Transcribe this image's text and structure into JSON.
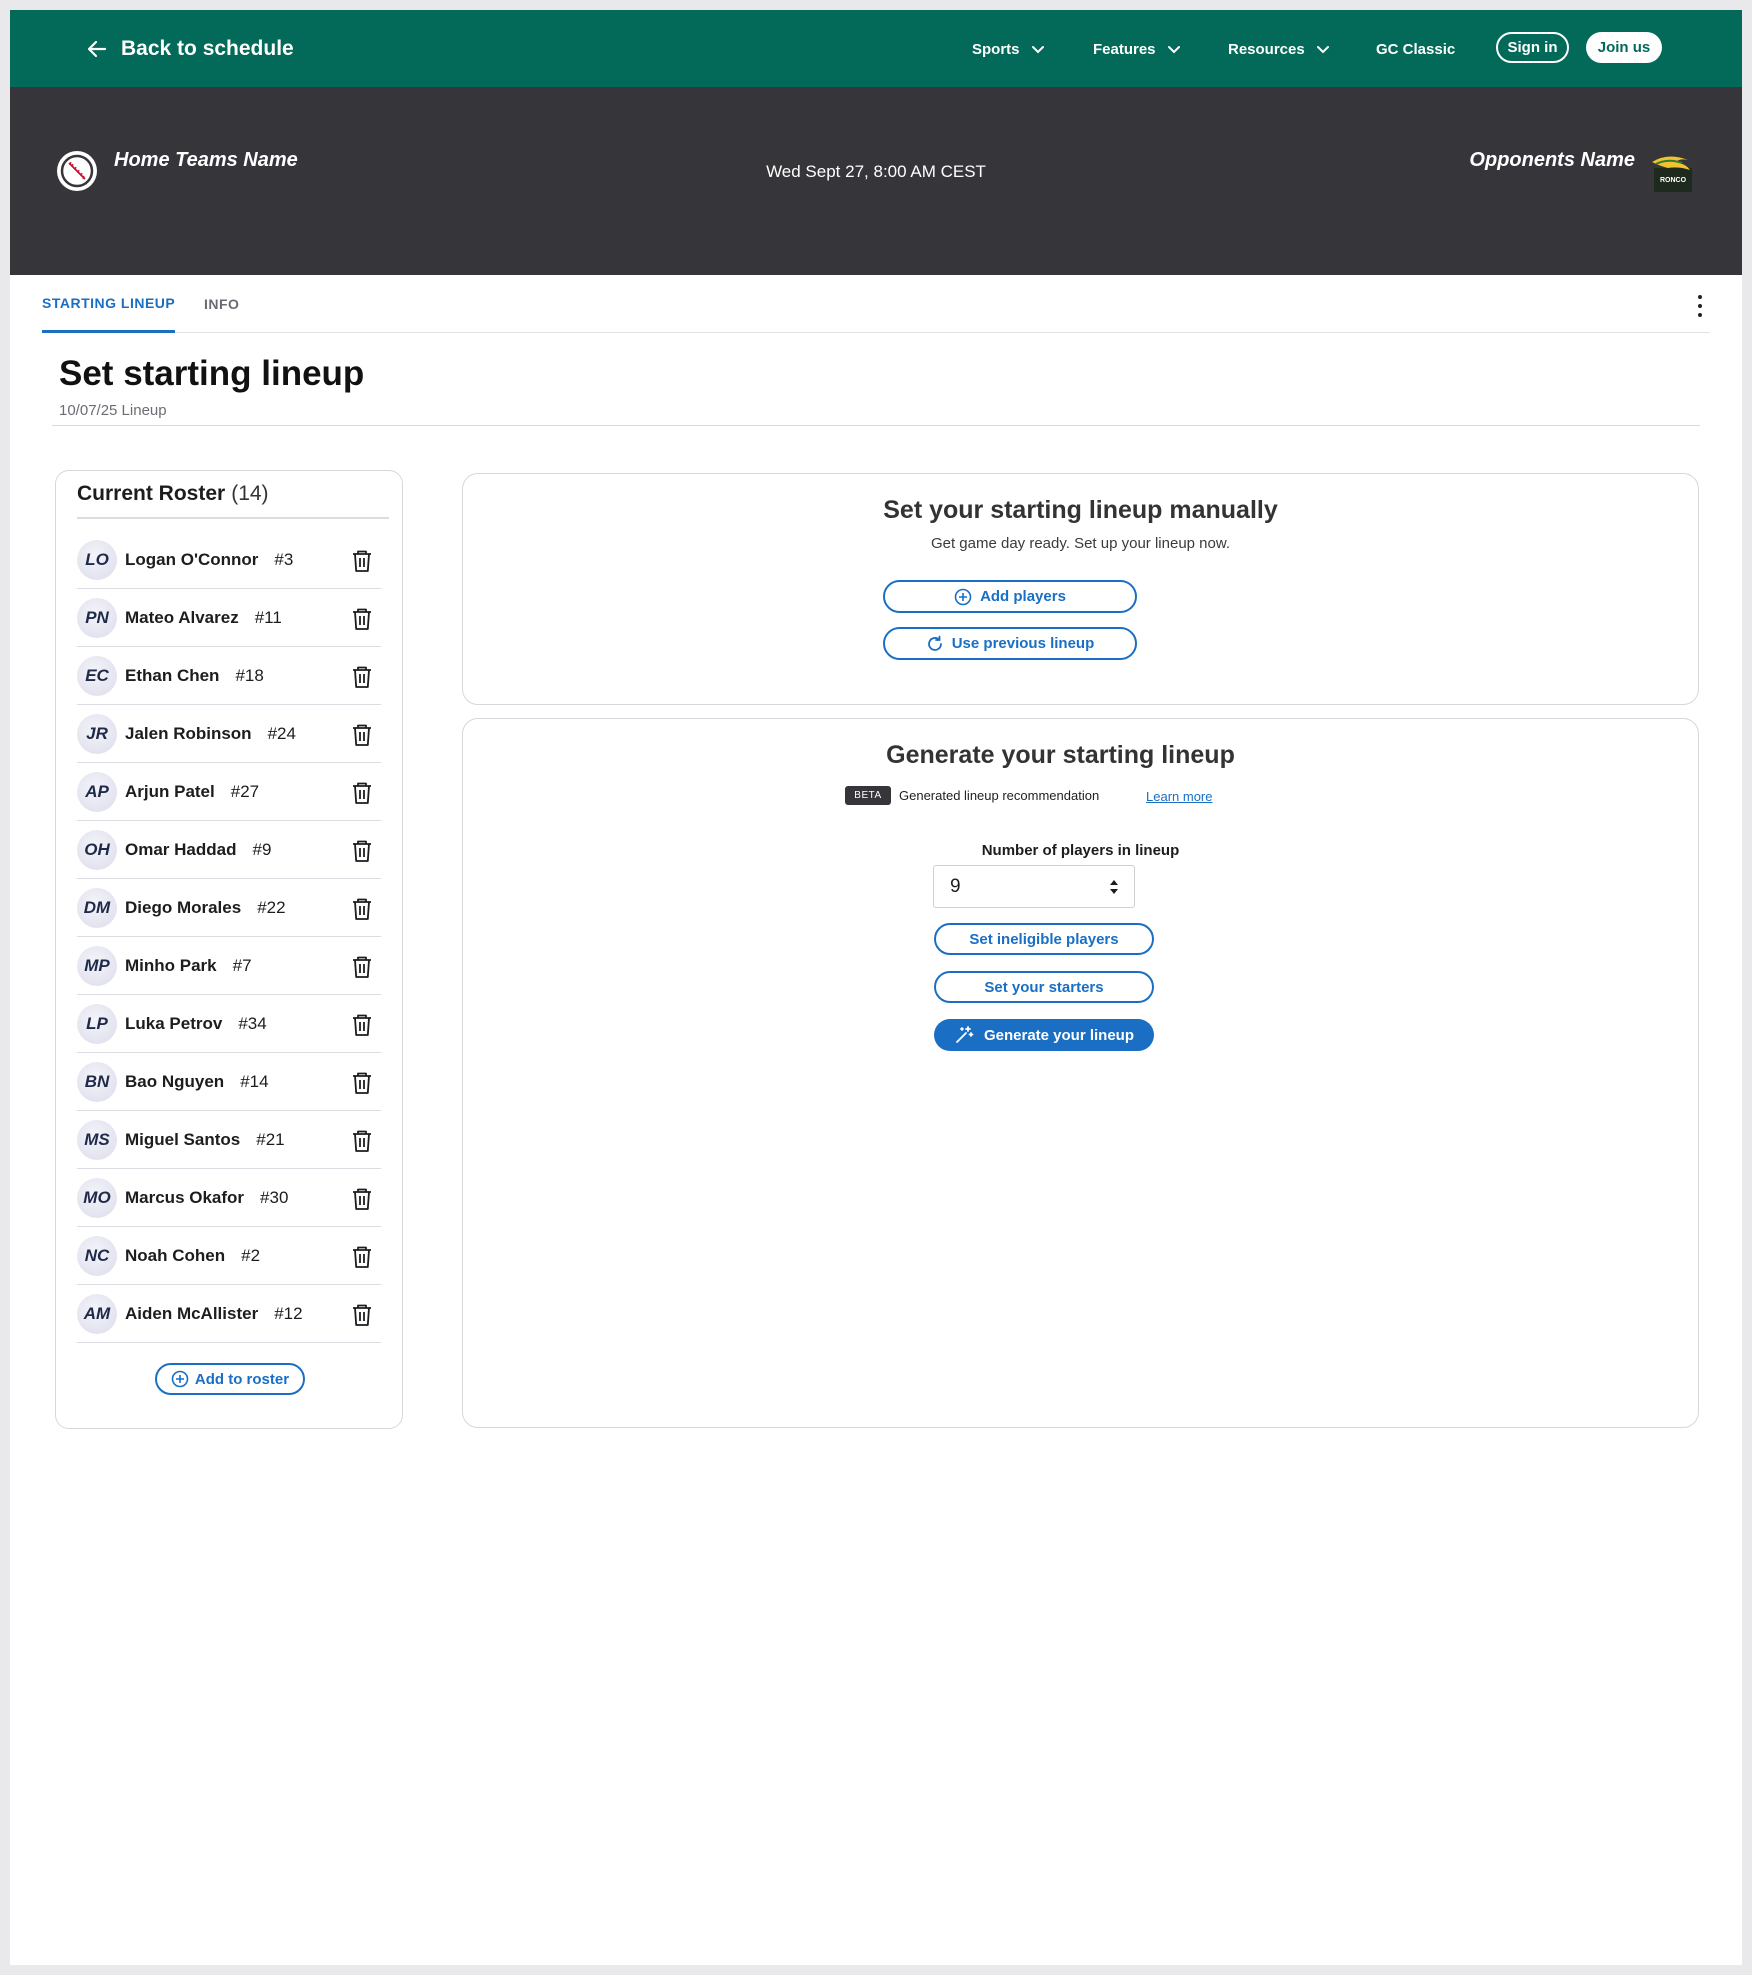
{
  "nav": {
    "back_label": "Back to schedule",
    "items": [
      "Sports",
      "Features",
      "Resources"
    ],
    "gc_classic": "GC Classic",
    "sign_in": "Sign in",
    "join_us": "Join us",
    "colors": {
      "brand": "#036958",
      "header_dark": "#36363a",
      "accent": "#1a6fc4"
    }
  },
  "game": {
    "home_name": "Home Teams Name",
    "time": "Wed Sept 27, 8:00 AM CEST",
    "away_name": "Opponents Name",
    "away_logo_text": "RONCO"
  },
  "tabs": [
    {
      "label": "STARTING LINEUP",
      "active": true
    },
    {
      "label": "INFO",
      "active": false
    }
  ],
  "page": {
    "title": "Set starting lineup",
    "subtitle": "10/07/25 Lineup"
  },
  "roster": {
    "title": "Current Roster",
    "count": "(14)",
    "players": [
      {
        "initials": "LO",
        "name": "Logan O'Connor",
        "number": "#3"
      },
      {
        "initials": "PN",
        "name": "Mateo Alvarez",
        "number": "#11"
      },
      {
        "initials": "EC",
        "name": "Ethan Chen",
        "number": "#18"
      },
      {
        "initials": "JR",
        "name": "Jalen Robinson",
        "number": "#24"
      },
      {
        "initials": "AP",
        "name": "Arjun Patel",
        "number": "#27"
      },
      {
        "initials": "OH",
        "name": "Omar Haddad",
        "number": "#9"
      },
      {
        "initials": "DM",
        "name": "Diego Morales",
        "number": "#22"
      },
      {
        "initials": "MP",
        "name": "Minho Park",
        "number": "#7"
      },
      {
        "initials": "LP",
        "name": "Luka Petrov",
        "number": "#34"
      },
      {
        "initials": "BN",
        "name": "Bao Nguyen",
        "number": "#14"
      },
      {
        "initials": "MS",
        "name": "Miguel Santos",
        "number": "#21"
      },
      {
        "initials": "MO",
        "name": "Marcus Okafor",
        "number": "#30"
      },
      {
        "initials": "NC",
        "name": "Noah Cohen",
        "number": "#2"
      },
      {
        "initials": "AM",
        "name": "Aiden McAllister",
        "number": "#12"
      }
    ],
    "add_label": "Add to roster"
  },
  "manual": {
    "title": "Set your starting lineup manually",
    "subtitle": "Get game day ready.  Set up your lineup now.",
    "add_players": "Add players",
    "use_previous": "Use previous lineup"
  },
  "generate": {
    "title": "Generate your starting lineup",
    "beta": "BETA",
    "beta_text": "Generated lineup recommendation",
    "learn_more": "Learn more",
    "num_label": "Number of players in lineup",
    "num_value": "9",
    "ineligible": "Set ineligible players",
    "starters": "Set your starters",
    "generate_btn": "Generate your lineup"
  }
}
